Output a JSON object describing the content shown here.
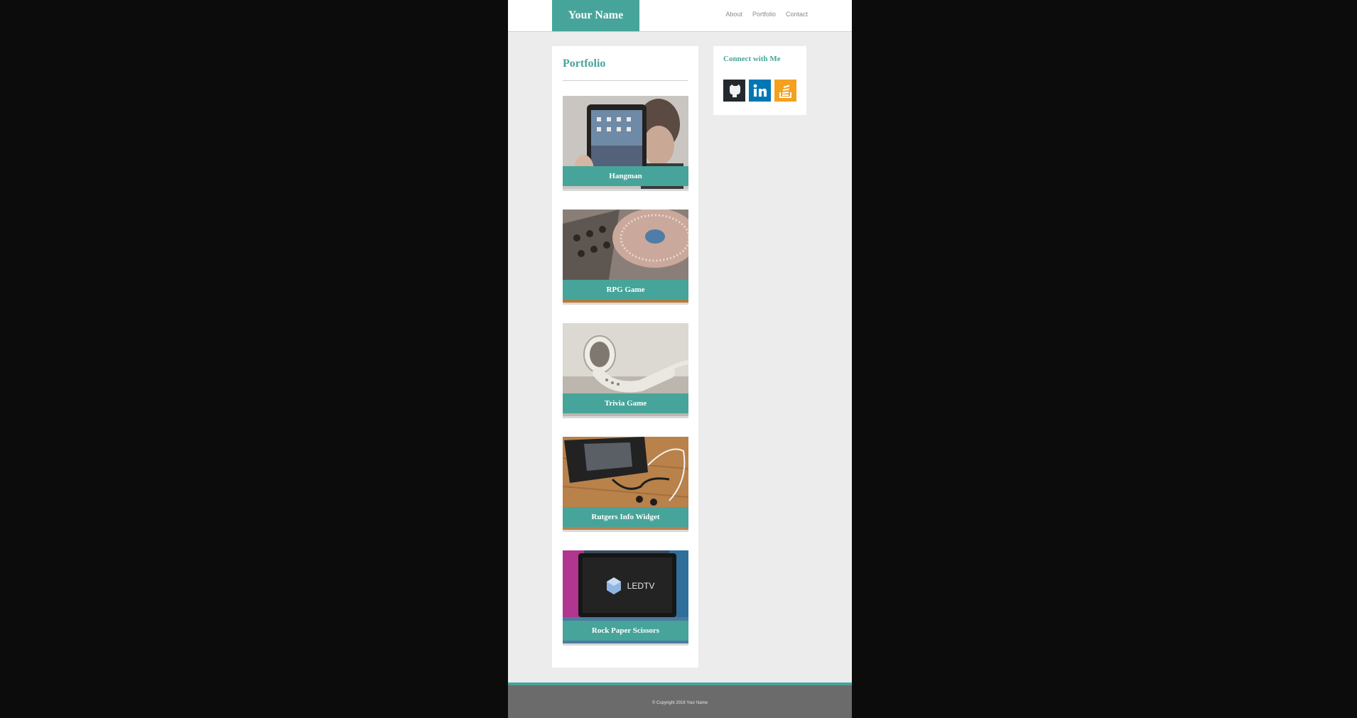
{
  "header": {
    "brand": "Your Name",
    "nav": [
      "About",
      "Portfolio",
      "Contact"
    ]
  },
  "portfolio": {
    "title": "Portfolio",
    "items": [
      {
        "label": "Hangman"
      },
      {
        "label": "RPG Game"
      },
      {
        "label": "Trivia Game"
      },
      {
        "label": "Rutgers Info Widget"
      },
      {
        "label": "Rock Paper Scissors"
      }
    ],
    "tv_logo_text": "LEDTV"
  },
  "connect": {
    "title": "Connect with Me",
    "links": [
      "github-icon",
      "linkedin-icon",
      "stackoverflow-icon"
    ]
  },
  "footer": {
    "copyright": "© Copyright 2016 Your Name"
  },
  "colors": {
    "accent": "#47a49a",
    "footer": "#6b6b6b",
    "page_background": "#0c0c0c",
    "github": "#24292e",
    "linkedin": "#0077b5",
    "stackoverflow": "#f48024"
  }
}
